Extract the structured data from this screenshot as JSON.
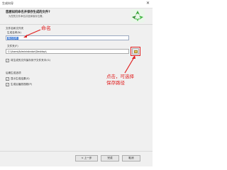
{
  "window": {
    "title": "生成向导"
  },
  "header": {
    "heading": "您想如何命名并保存生成的文件?",
    "subheading": "为您的文件命名并选择保存位置。"
  },
  "output": {
    "group_label": "文件名和文件夹",
    "name_label": "生成名称(N)",
    "name_value": "输出名称",
    "folder_label": "文件夹(F)",
    "folder_value": "C:\\Users\\Administrator\\Desktop\\",
    "browse_icon": "folder-icon",
    "organize_option": {
      "label": "将生成的文件保存到子文件夹中(G)",
      "checked": true
    }
  },
  "post": {
    "group_label": "后期生成选项",
    "options": [
      {
        "label": "显示生成结果(S)",
        "checked": true
      },
      {
        "label": "生成后播放视频(P)",
        "checked": true
      }
    ]
  },
  "footer": {
    "back": "< 上一步",
    "finish": "完成",
    "cancel": "取消"
  },
  "annotations": {
    "name_note": "命名",
    "save_note_line1": "点击，可选择",
    "save_note_line2": "保存路径",
    "color": "#e02020"
  },
  "colors": {
    "brand": "#3aa83a",
    "selection": "#3b7ad8"
  }
}
